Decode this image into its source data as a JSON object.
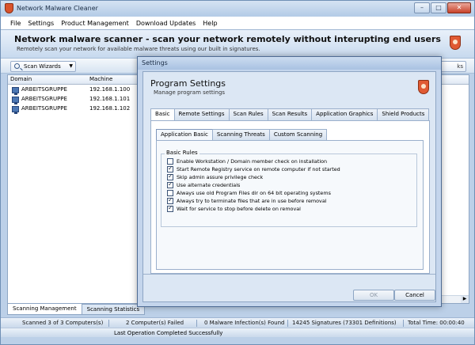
{
  "window": {
    "title": "Network Malware Cleaner",
    "controls": {
      "minimize": "–",
      "maximize": "□",
      "close": "✕"
    }
  },
  "menu": [
    "File",
    "Settings",
    "Product Management",
    "Download Updates",
    "Help"
  ],
  "header": {
    "title": "Network malware scanner - scan your network remotely without interupting end users",
    "subtitle": "Remotely scan your network for available malware threats using our built in signatures."
  },
  "toolbar": {
    "scan_wizards": "Scan Wizards",
    "right_button": "ks"
  },
  "grid": {
    "columns": [
      "Domain",
      "Machine"
    ],
    "rows": [
      {
        "domain": "ARBEITSGRUPPE",
        "machine": "192.168.1.100"
      },
      {
        "domain": "ARBEITSGRUPPE",
        "machine": "192.168.1.101"
      },
      {
        "domain": "ARBEITSGRUPPE",
        "machine": "192.168.1.102"
      }
    ]
  },
  "bottom_tabs": [
    "Scanning Management",
    "Scanning Statistics"
  ],
  "status": {
    "scanned": "Scanned 3 of 3 Computers(s)",
    "failed": "2 Computer(s) Failed",
    "infections": "0 Malware Infection(s) Found",
    "signatures": "14245 Signatures (73301 Definitions)",
    "total_time": "Total Time: 00:00:40",
    "last_op": "Last Operation Completed Successfully"
  },
  "dialog": {
    "title": "Settings",
    "heading": "Program Settings",
    "subheading": "Manage program settings",
    "outer_tabs": [
      "Basic",
      "Remote Settings",
      "Scan Rules",
      "Scan Results",
      "Application Graphics",
      "Shield Products"
    ],
    "inner_tabs": [
      "Application Basic",
      "Scanning Threats",
      "Custom Scanning"
    ],
    "group_label": "Basic Rules",
    "options": [
      {
        "label": "Enable Workstation / Domain member check on installation",
        "checked": false
      },
      {
        "label": "Start Remote Registry service on remote computer if not started",
        "checked": true
      },
      {
        "label": "Skip admin assure privilege check",
        "checked": true
      },
      {
        "label": "Use alternate credentials",
        "checked": true
      },
      {
        "label": "Always use old Program Files dir on 64  bit operating systems",
        "checked": false
      },
      {
        "label": "Always try to terminate files that are in use before removal",
        "checked": true
      },
      {
        "label": "Wait for service to stop before delete on removal",
        "checked": true
      }
    ],
    "ok": "OK",
    "cancel": "Cancel"
  }
}
